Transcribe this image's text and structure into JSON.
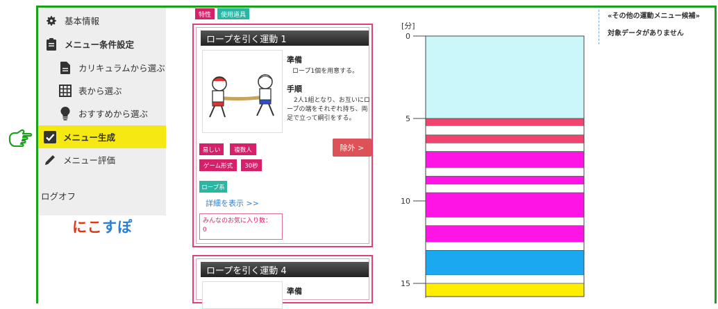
{
  "sidebar": {
    "items": [
      {
        "label": "基本情報",
        "icon": "gear-icon"
      },
      {
        "label": "メニュー条件設定",
        "icon": "clipboard-icon"
      },
      {
        "label": "カリキュラムから選ぶ",
        "icon": "document-icon"
      },
      {
        "label": "表から選ぶ",
        "icon": "grid-icon"
      },
      {
        "label": "おすすめから選ぶ",
        "icon": "lightbulb-icon"
      },
      {
        "label": "メニュー生成",
        "icon": "checkbox-icon"
      },
      {
        "label": "メニュー評価",
        "icon": "pencil-icon"
      }
    ],
    "logoff": "ログオフ",
    "logo": {
      "part1": "にこ",
      "part2": "すぽ"
    }
  },
  "top_tags": [
    "特性",
    "使用道具"
  ],
  "cards": [
    {
      "title": "ロープを引く運動 1",
      "prep_heading": "準備",
      "prep_text": "ロープ1個を用意する。",
      "steps_heading": "手順",
      "steps_text": "2人1組となり、お互いにロープの端をそれぞれ持ち、両足で立って綱引をする。",
      "tags": [
        "易しい",
        "複数人",
        "ゲーム形式",
        "30秒"
      ],
      "tool_tag": "ロープ系",
      "exclude_label": "除外 >",
      "detail_link": "詳細を表示 >>",
      "favorite_text": "みんなのお気に入り数：",
      "favorite_count": "0"
    },
    {
      "title": "ロープを引く運動 4",
      "prep_heading": "準備"
    }
  ],
  "right_panel": {
    "title": "«その他の運動メニュー候補»",
    "text": "対象データがありません"
  },
  "chart_data": {
    "type": "bar",
    "unit_label": "[分]",
    "y_ticks": [
      0,
      5,
      10,
      15
    ],
    "ylim": [
      0,
      15.8
    ],
    "segments": [
      {
        "start": 0,
        "end": 5.0,
        "color": "#ccf7fa"
      },
      {
        "start": 5.0,
        "end": 5.45,
        "color": "#f2426e"
      },
      {
        "start": 5.45,
        "end": 6.0,
        "color": "#ffffff"
      },
      {
        "start": 6.0,
        "end": 6.5,
        "color": "#f2426e"
      },
      {
        "start": 6.5,
        "end": 7.0,
        "color": "#ffffff"
      },
      {
        "start": 7.0,
        "end": 8.0,
        "color": "#ff14e6"
      },
      {
        "start": 8.0,
        "end": 8.5,
        "color": "#ffffff"
      },
      {
        "start": 8.5,
        "end": 9.0,
        "color": "#ff14e6"
      },
      {
        "start": 9.0,
        "end": 9.5,
        "color": "#ffffff"
      },
      {
        "start": 9.5,
        "end": 11.0,
        "color": "#ff14e6"
      },
      {
        "start": 11.0,
        "end": 11.5,
        "color": "#ffffff"
      },
      {
        "start": 11.5,
        "end": 12.5,
        "color": "#ff14e6"
      },
      {
        "start": 12.5,
        "end": 13.0,
        "color": "#ffffff"
      },
      {
        "start": 13.0,
        "end": 14.5,
        "color": "#1aa9f0"
      },
      {
        "start": 14.5,
        "end": 15.0,
        "color": "#ffffff"
      },
      {
        "start": 15.0,
        "end": 15.8,
        "color": "#ffee00"
      }
    ]
  },
  "colors": {
    "frame": "#1aa01a",
    "active": "#f5e813",
    "card_border": "#e0407a"
  }
}
